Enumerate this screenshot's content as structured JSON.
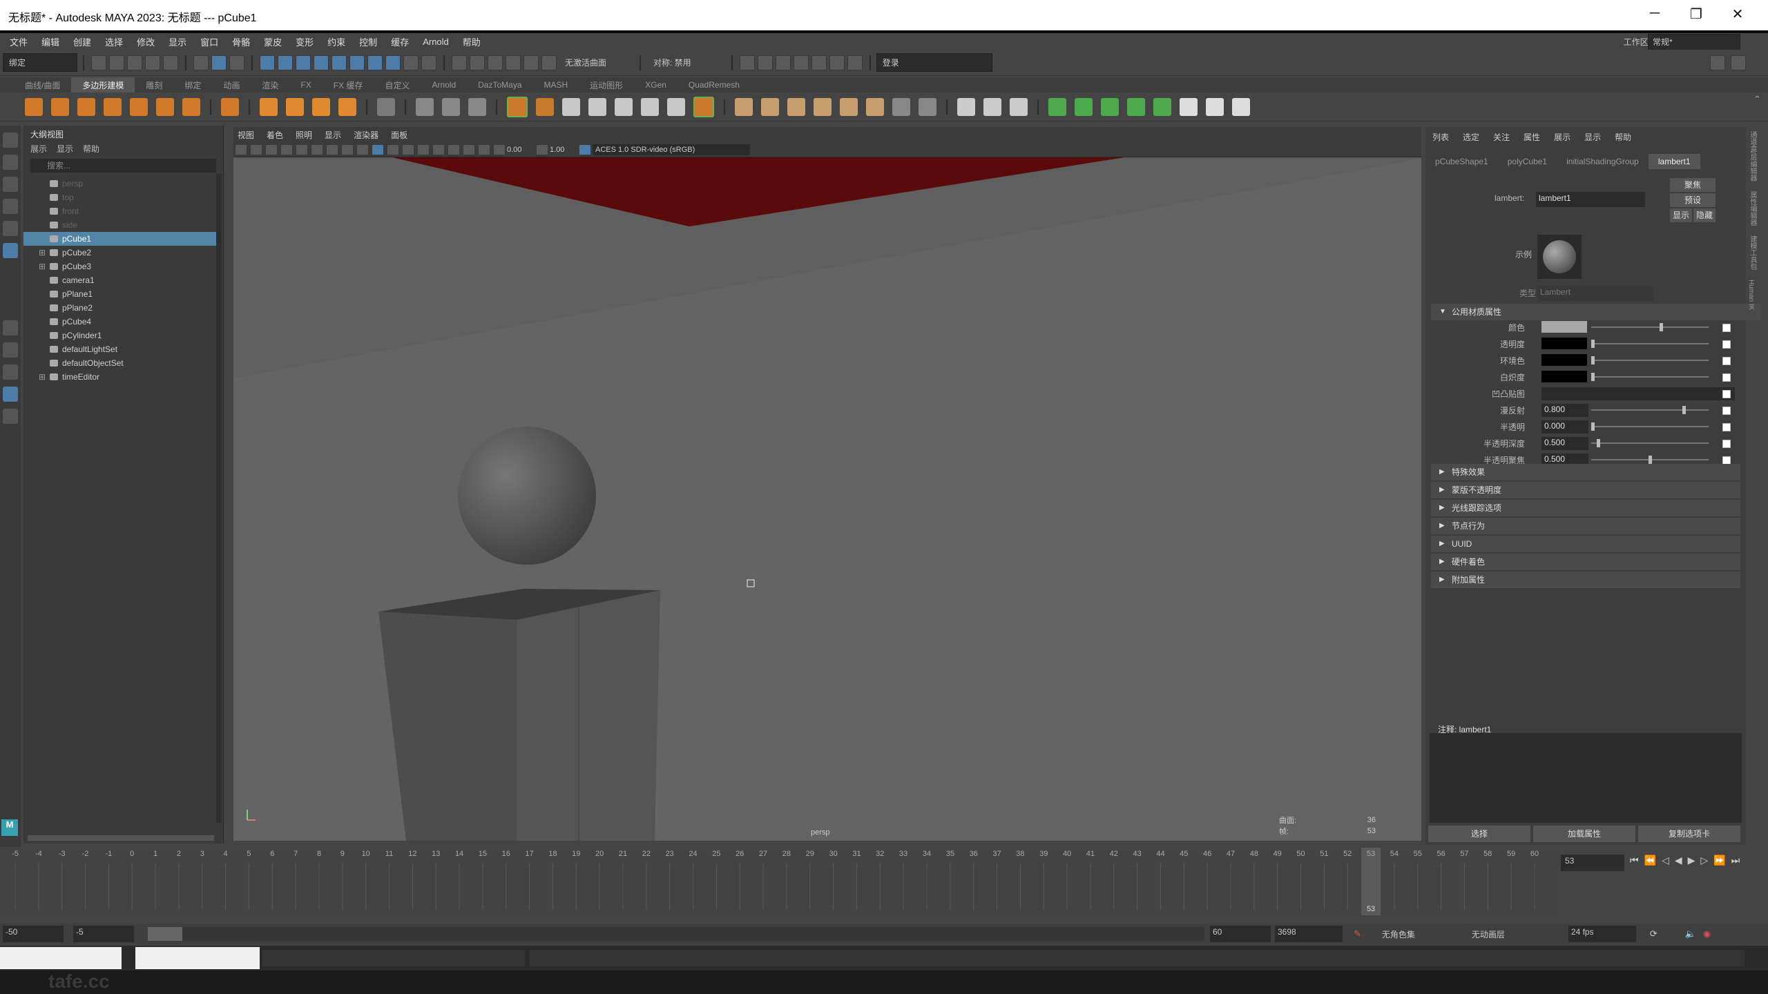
{
  "window": {
    "title": "无标题* - Autodesk MAYA 2023: 无标题   ---   pCube1",
    "minimize": "─",
    "maximize": "❐",
    "close": "✕"
  },
  "menubar": {
    "items": [
      "文件",
      "编辑",
      "创建",
      "选择",
      "修改",
      "显示",
      "窗口",
      "骨骼",
      "蒙皮",
      "变形",
      "约束",
      "控制",
      "缓存",
      "Arnold",
      "帮助"
    ],
    "workspace_label": "工作区:",
    "workspace_value": "常规*"
  },
  "statusline": {
    "mode": "绑定",
    "live_surface": "无激活曲面",
    "symmetry": "对称: 禁用",
    "login": "登录"
  },
  "shelf": {
    "tabs": [
      "曲线/曲面",
      "多边形建模",
      "雕刻",
      "绑定",
      "动画",
      "渲染",
      "FX",
      "FX 缓存",
      "自定义",
      "Arnold",
      "DazToMaya",
      "MASH",
      "运动图形",
      "XGen",
      "QuadRemesh"
    ],
    "active": "多边形建模"
  },
  "outliner": {
    "title": "大纲视图",
    "menu": [
      "展示",
      "显示",
      "帮助"
    ],
    "search_placeholder": "搜索...",
    "items": [
      {
        "label": "persp",
        "dim": true
      },
      {
        "label": "top",
        "dim": true
      },
      {
        "label": "front",
        "dim": true
      },
      {
        "label": "side",
        "dim": true
      },
      {
        "label": "pCube1",
        "selected": true
      },
      {
        "label": "pCube2",
        "expand": true
      },
      {
        "label": "pCube3",
        "expand": true
      },
      {
        "label": "camera1"
      },
      {
        "label": "pPlane1"
      },
      {
        "label": "pPlane2"
      },
      {
        "label": "pCube4"
      },
      {
        "label": "pCylinder1"
      },
      {
        "label": "defaultLightSet"
      },
      {
        "label": "defaultObjectSet"
      },
      {
        "label": "timeEditor",
        "expand": true
      }
    ]
  },
  "viewport": {
    "menu": [
      "视图",
      "着色",
      "照明",
      "显示",
      "渲染器",
      "面板"
    ],
    "exposure": "0.00",
    "gamma": "1.00",
    "color_space": "ACES 1.0 SDR-video (sRGB)",
    "camera": "persp",
    "hud": [
      {
        "label": "曲面:",
        "value": "36"
      },
      {
        "label": "帧:",
        "value": "53"
      }
    ]
  },
  "attribute_editor": {
    "menu": [
      "列表",
      "选定",
      "关注",
      "属性",
      "展示",
      "显示",
      "帮助"
    ],
    "tabs": [
      "pCubeShape1",
      "polyCube1",
      "initialShadingGroup",
      "lambert1"
    ],
    "active_tab": "lambert1",
    "node_label": "lambert:",
    "node_name": "lambert1",
    "btn_focus": "聚焦",
    "btn_presets": "预设",
    "btn_show": "显示",
    "btn_hide": "隐藏",
    "sample_label": "示例",
    "type_label": "类型",
    "type_value": "Lambert",
    "common_section": "公用材质属性",
    "attrs": [
      {
        "label": "颜色",
        "swatch": "#a8a8a8",
        "slider": 0.6
      },
      {
        "label": "透明度",
        "swatch": "#000000",
        "slider": 0.0
      },
      {
        "label": "环境色",
        "swatch": "#000000",
        "slider": 0.0
      },
      {
        "label": "白炽度",
        "swatch": "#000000",
        "slider": 0.0
      },
      {
        "label": "凹凸贴图",
        "value": ""
      },
      {
        "label": "漫反射",
        "value": "0.800",
        "slider": 0.8
      },
      {
        "label": "半透明",
        "value": "0.000",
        "slider": 0.0
      },
      {
        "label": "半透明深度",
        "value": "0.500",
        "slider": 0.05
      },
      {
        "label": "半透明聚焦",
        "value": "0.500",
        "slider": 0.5
      }
    ],
    "sections": [
      "特殊效果",
      "蒙版不透明度",
      "光线跟踪选项",
      "节点行为",
      "UUID",
      "硬件着色",
      "附加属性"
    ],
    "notes_label": "注释: lambert1",
    "btn_select": "选择",
    "btn_load": "加载属性",
    "btn_copy": "复制选项卡",
    "side_tabs": [
      "通道盒/层编辑器",
      "属性编辑器",
      "建模工具包",
      "Human IK"
    ]
  },
  "timeline": {
    "ticks": [
      "-5",
      "-4",
      "-3",
      "-2",
      "-1",
      "0",
      "1",
      "2",
      "3",
      "4",
      "5",
      "6",
      "7",
      "8",
      "9",
      "10",
      "11",
      "12",
      "13",
      "14",
      "15",
      "16",
      "17",
      "18",
      "19",
      "20",
      "21",
      "22",
      "23",
      "24",
      "25",
      "26",
      "27",
      "28",
      "29",
      "30",
      "31",
      "32",
      "33",
      "34",
      "35",
      "36",
      "37",
      "38",
      "39",
      "40",
      "41",
      "42",
      "43",
      "44",
      "45",
      "46",
      "47",
      "48",
      "49",
      "50",
      "51",
      "52",
      "53",
      "54",
      "55",
      "56",
      "57",
      "58",
      "59",
      "60"
    ],
    "current_frame": "53",
    "current_field": "53"
  },
  "range": {
    "start": "-50",
    "playback_start": "-5",
    "playback_end": "60",
    "end": "3698",
    "char_set": "无角色集",
    "anim_layer": "无动画层",
    "fps": "24 fps"
  },
  "watermark": "tafe.cc"
}
